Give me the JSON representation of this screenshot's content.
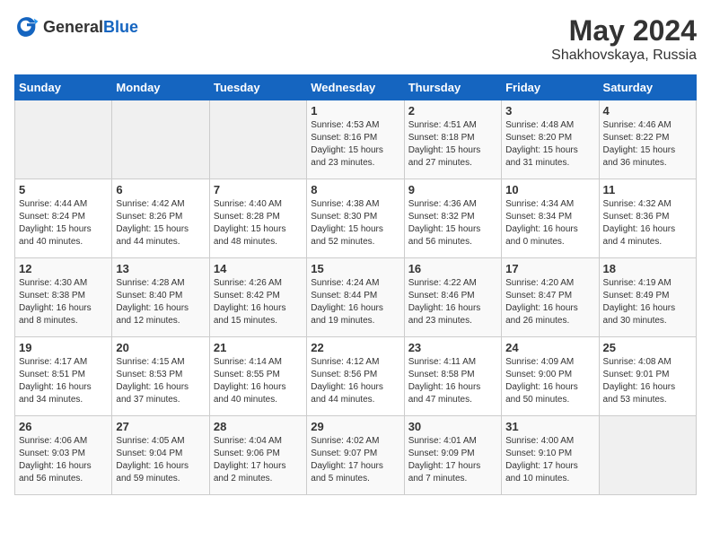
{
  "logo": {
    "general": "General",
    "blue": "Blue"
  },
  "title": "May 2024",
  "subtitle": "Shakhovskaya, Russia",
  "days_header": [
    "Sunday",
    "Monday",
    "Tuesday",
    "Wednesday",
    "Thursday",
    "Friday",
    "Saturday"
  ],
  "weeks": [
    [
      {
        "day": "",
        "info": ""
      },
      {
        "day": "",
        "info": ""
      },
      {
        "day": "",
        "info": ""
      },
      {
        "day": "1",
        "info": "Sunrise: 4:53 AM\nSunset: 8:16 PM\nDaylight: 15 hours\nand 23 minutes."
      },
      {
        "day": "2",
        "info": "Sunrise: 4:51 AM\nSunset: 8:18 PM\nDaylight: 15 hours\nand 27 minutes."
      },
      {
        "day": "3",
        "info": "Sunrise: 4:48 AM\nSunset: 8:20 PM\nDaylight: 15 hours\nand 31 minutes."
      },
      {
        "day": "4",
        "info": "Sunrise: 4:46 AM\nSunset: 8:22 PM\nDaylight: 15 hours\nand 36 minutes."
      }
    ],
    [
      {
        "day": "5",
        "info": "Sunrise: 4:44 AM\nSunset: 8:24 PM\nDaylight: 15 hours\nand 40 minutes."
      },
      {
        "day": "6",
        "info": "Sunrise: 4:42 AM\nSunset: 8:26 PM\nDaylight: 15 hours\nand 44 minutes."
      },
      {
        "day": "7",
        "info": "Sunrise: 4:40 AM\nSunset: 8:28 PM\nDaylight: 15 hours\nand 48 minutes."
      },
      {
        "day": "8",
        "info": "Sunrise: 4:38 AM\nSunset: 8:30 PM\nDaylight: 15 hours\nand 52 minutes."
      },
      {
        "day": "9",
        "info": "Sunrise: 4:36 AM\nSunset: 8:32 PM\nDaylight: 15 hours\nand 56 minutes."
      },
      {
        "day": "10",
        "info": "Sunrise: 4:34 AM\nSunset: 8:34 PM\nDaylight: 16 hours\nand 0 minutes."
      },
      {
        "day": "11",
        "info": "Sunrise: 4:32 AM\nSunset: 8:36 PM\nDaylight: 16 hours\nand 4 minutes."
      }
    ],
    [
      {
        "day": "12",
        "info": "Sunrise: 4:30 AM\nSunset: 8:38 PM\nDaylight: 16 hours\nand 8 minutes."
      },
      {
        "day": "13",
        "info": "Sunrise: 4:28 AM\nSunset: 8:40 PM\nDaylight: 16 hours\nand 12 minutes."
      },
      {
        "day": "14",
        "info": "Sunrise: 4:26 AM\nSunset: 8:42 PM\nDaylight: 16 hours\nand 15 minutes."
      },
      {
        "day": "15",
        "info": "Sunrise: 4:24 AM\nSunset: 8:44 PM\nDaylight: 16 hours\nand 19 minutes."
      },
      {
        "day": "16",
        "info": "Sunrise: 4:22 AM\nSunset: 8:46 PM\nDaylight: 16 hours\nand 23 minutes."
      },
      {
        "day": "17",
        "info": "Sunrise: 4:20 AM\nSunset: 8:47 PM\nDaylight: 16 hours\nand 26 minutes."
      },
      {
        "day": "18",
        "info": "Sunrise: 4:19 AM\nSunset: 8:49 PM\nDaylight: 16 hours\nand 30 minutes."
      }
    ],
    [
      {
        "day": "19",
        "info": "Sunrise: 4:17 AM\nSunset: 8:51 PM\nDaylight: 16 hours\nand 34 minutes."
      },
      {
        "day": "20",
        "info": "Sunrise: 4:15 AM\nSunset: 8:53 PM\nDaylight: 16 hours\nand 37 minutes."
      },
      {
        "day": "21",
        "info": "Sunrise: 4:14 AM\nSunset: 8:55 PM\nDaylight: 16 hours\nand 40 minutes."
      },
      {
        "day": "22",
        "info": "Sunrise: 4:12 AM\nSunset: 8:56 PM\nDaylight: 16 hours\nand 44 minutes."
      },
      {
        "day": "23",
        "info": "Sunrise: 4:11 AM\nSunset: 8:58 PM\nDaylight: 16 hours\nand 47 minutes."
      },
      {
        "day": "24",
        "info": "Sunrise: 4:09 AM\nSunset: 9:00 PM\nDaylight: 16 hours\nand 50 minutes."
      },
      {
        "day": "25",
        "info": "Sunrise: 4:08 AM\nSunset: 9:01 PM\nDaylight: 16 hours\nand 53 minutes."
      }
    ],
    [
      {
        "day": "26",
        "info": "Sunrise: 4:06 AM\nSunset: 9:03 PM\nDaylight: 16 hours\nand 56 minutes."
      },
      {
        "day": "27",
        "info": "Sunrise: 4:05 AM\nSunset: 9:04 PM\nDaylight: 16 hours\nand 59 minutes."
      },
      {
        "day": "28",
        "info": "Sunrise: 4:04 AM\nSunset: 9:06 PM\nDaylight: 17 hours\nand 2 minutes."
      },
      {
        "day": "29",
        "info": "Sunrise: 4:02 AM\nSunset: 9:07 PM\nDaylight: 17 hours\nand 5 minutes."
      },
      {
        "day": "30",
        "info": "Sunrise: 4:01 AM\nSunset: 9:09 PM\nDaylight: 17 hours\nand 7 minutes."
      },
      {
        "day": "31",
        "info": "Sunrise: 4:00 AM\nSunset: 9:10 PM\nDaylight: 17 hours\nand 10 minutes."
      },
      {
        "day": "",
        "info": ""
      }
    ]
  ]
}
